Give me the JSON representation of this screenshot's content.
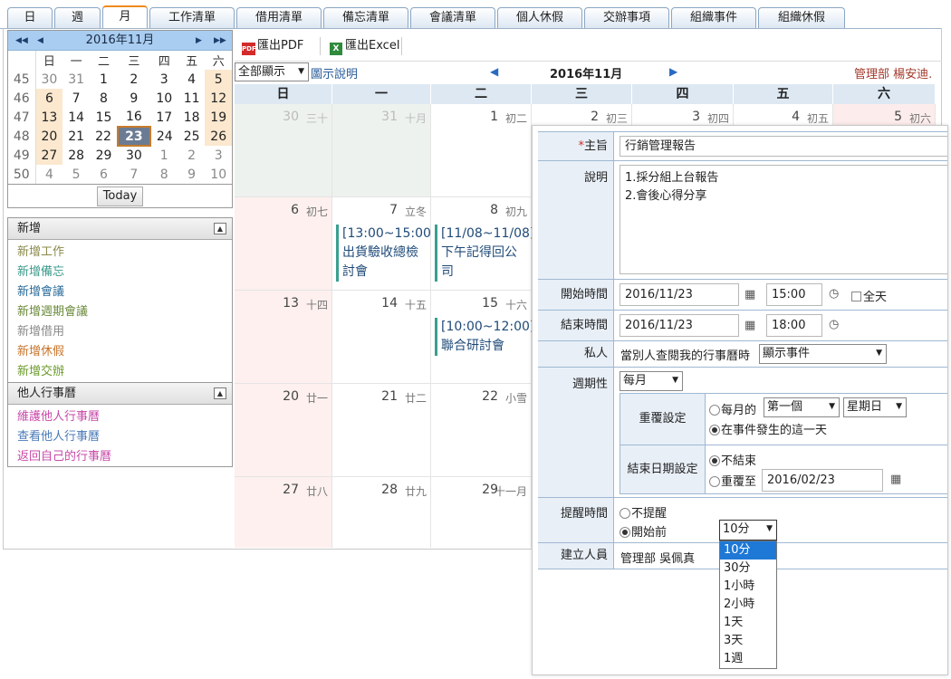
{
  "tabs": [
    "日",
    "週",
    "月",
    "工作清單",
    "借用清單",
    "備忘清單",
    "會議清單",
    "個人休假",
    "交辦事項",
    "組織事件",
    "組織休假"
  ],
  "mini_calendar": {
    "nav_prev_year": "◀◀",
    "nav_prev": "◀",
    "nav_next": "▶",
    "nav_next_year": "▶▶",
    "title": "2016年11月",
    "weekdays": [
      "日",
      "一",
      "二",
      "三",
      "四",
      "五",
      "六"
    ],
    "weeks": [
      {
        "wk": "45",
        "days": [
          "30",
          "31",
          "1",
          "2",
          "3",
          "4",
          "5"
        ]
      },
      {
        "wk": "46",
        "days": [
          "6",
          "7",
          "8",
          "9",
          "10",
          "11",
          "12"
        ]
      },
      {
        "wk": "47",
        "days": [
          "13",
          "14",
          "15",
          "16",
          "17",
          "18",
          "19"
        ]
      },
      {
        "wk": "48",
        "days": [
          "20",
          "21",
          "22",
          "23",
          "24",
          "25",
          "26"
        ]
      },
      {
        "wk": "49",
        "days": [
          "27",
          "28",
          "29",
          "30",
          "1",
          "2",
          "3"
        ]
      },
      {
        "wk": "50",
        "days": [
          "4",
          "5",
          "6",
          "7",
          "8",
          "9",
          "10"
        ]
      }
    ],
    "today_label": "Today"
  },
  "add_panel": {
    "title": "新增",
    "items": [
      {
        "label": "新增工作",
        "color": "#8a8a4a"
      },
      {
        "label": "新增備忘",
        "color": "#3a9a8a"
      },
      {
        "label": "新增會議",
        "color": "#2a6a9a"
      },
      {
        "label": "新增週期會議",
        "color": "#6a8a3a"
      },
      {
        "label": "新增借用",
        "color": "#8a8a8a"
      },
      {
        "label": "新增休假",
        "color": "#c8742a"
      },
      {
        "label": "新增交辦",
        "color": "#6a9a2a"
      }
    ]
  },
  "others_panel": {
    "title": "他人行事曆",
    "items": [
      {
        "label": "維護他人行事曆",
        "color": "#c84aa8"
      },
      {
        "label": "查看他人行事曆",
        "color": "#4a7ab8"
      },
      {
        "label": "返回自己的行事曆",
        "color": "#c84aa8"
      }
    ]
  },
  "toolbar": {
    "pdf_icon": "PDF",
    "pdf_label": "匯出PDF",
    "excel_icon": "X",
    "excel_label": "匯出Excel"
  },
  "filter": {
    "display_value": "全部顯示",
    "legend_link": "圖示說明",
    "month_title": "2016年11月",
    "user": "管理部 楊安迪."
  },
  "calendar": {
    "weekdays": [
      "日",
      "一",
      "二",
      "三",
      "四",
      "五",
      "六"
    ],
    "weeks": [
      [
        {
          "d": "30",
          "l": "三十"
        },
        {
          "d": "31",
          "l": "十月"
        },
        {
          "d": "1",
          "l": "初二"
        },
        {
          "d": "2",
          "l": "初三"
        },
        {
          "d": "3",
          "l": "初四"
        },
        {
          "d": "4",
          "l": "初五"
        },
        {
          "d": "5",
          "l": "初六"
        }
      ],
      [
        {
          "d": "6",
          "l": "初七"
        },
        {
          "d": "7",
          "l": "立冬"
        },
        {
          "d": "8",
          "l": "初九"
        }
      ],
      [
        {
          "d": "13",
          "l": "十四"
        },
        {
          "d": "14",
          "l": "十五"
        },
        {
          "d": "15",
          "l": "十六"
        }
      ],
      [
        {
          "d": "20",
          "l": "廿一"
        },
        {
          "d": "21",
          "l": "廿二"
        },
        {
          "d": "22",
          "l": "小雪"
        }
      ],
      [
        {
          "d": "27",
          "l": "廿八"
        },
        {
          "d": "28",
          "l": "廿九"
        },
        {
          "d": "29",
          "l": "十一月"
        }
      ]
    ],
    "events": [
      {
        "time": "[13:00~15:00]",
        "line1": "出貨驗收總檢",
        "line2": "討會"
      },
      {
        "time": "[11/08~11/08]",
        "line1": "下午記得回公",
        "line2": "司"
      },
      {
        "time": "[10:00~12:00]",
        "line1": "聯合研討會",
        "line2": ""
      }
    ]
  },
  "form": {
    "subject_label": "主旨",
    "subject_required": "*",
    "subject_value": "行銷管理報告",
    "desc_label": "說明",
    "desc_line1": "1.採分組上台報告",
    "desc_line2": "2.會後心得分享",
    "start_label": "開始時間",
    "start_date": "2016/11/23",
    "start_time": "15:00",
    "allday_label": "全天",
    "end_label": "結束時間",
    "end_date": "2016/11/23",
    "end_time": "18:00",
    "private_label": "私人",
    "private_text": "當別人查閱我的行事曆時",
    "private_value": "顯示事件",
    "cycle_label": "週期性",
    "cycle_value": "每月",
    "repeat_label": "重覆設定",
    "repeat_opt1": "每月的",
    "repeat_week_value": "第一個",
    "repeat_day_value": "星期日",
    "repeat_opt2": "在事件發生的這一天",
    "enddate_label": "結束日期設定",
    "enddate_opt1": "不結束",
    "enddate_opt2": "重覆至",
    "enddate_value": "2016/02/23",
    "remind_label": "提醒時間",
    "remind_opt1": "不提醒",
    "remind_opt2": "開始前",
    "remind_value": "10分",
    "creator_label": "建立人員",
    "creator_value": "管理部 吳佩真",
    "remind_options": [
      "10分",
      "30分",
      "1小時",
      "2小時",
      "1天",
      "3天",
      "1週"
    ]
  }
}
